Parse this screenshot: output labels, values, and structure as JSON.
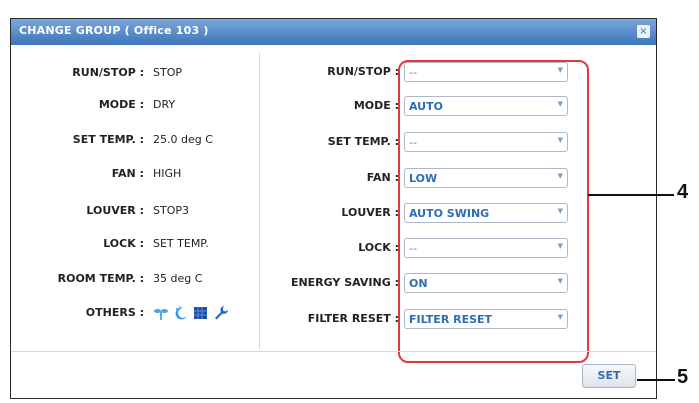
{
  "dialog": {
    "title": "CHANGE GROUP ( Office 103 )",
    "close_symbol": "×"
  },
  "status": {
    "run_stop": {
      "label": "RUN/STOP",
      "value": "STOP"
    },
    "mode": {
      "label": "MODE",
      "value": "DRY"
    },
    "set_temp": {
      "label": "SET TEMP.",
      "value": "25.0 deg C"
    },
    "fan": {
      "label": "FAN",
      "value": "HIGH"
    },
    "louver": {
      "label": "LOUVER",
      "value": "STOP3"
    },
    "lock": {
      "label": "LOCK",
      "value": "SET TEMP."
    },
    "room_temp": {
      "label": "ROOM TEMP.",
      "value": "35 deg C"
    },
    "others": {
      "label": "OTHERS",
      "icons": [
        "fan-sprout-icon",
        "night-moon-icon",
        "grid-panel-icon",
        "wrench-icon"
      ]
    }
  },
  "controls": {
    "run_stop": {
      "label": "RUN/STOP",
      "value": "--"
    },
    "mode": {
      "label": "MODE",
      "value": "AUTO"
    },
    "set_temp": {
      "label": "SET TEMP.",
      "value": "--"
    },
    "fan": {
      "label": "FAN",
      "value": "LOW"
    },
    "louver": {
      "label": "LOUVER",
      "value": "AUTO SWING"
    },
    "lock": {
      "label": "LOCK",
      "value": "--"
    },
    "energy_saving": {
      "label": "ENERGY SAVING",
      "value": "ON"
    },
    "filter_reset": {
      "label": "FILTER RESET",
      "value": "FILTER RESET"
    }
  },
  "footer": {
    "set_label": "SET"
  },
  "callouts": {
    "controls": "4",
    "set": "5"
  },
  "colors": {
    "title_bar": "#4f86c6",
    "highlight": "#e03a3a",
    "value_text": "#2e6db0"
  }
}
